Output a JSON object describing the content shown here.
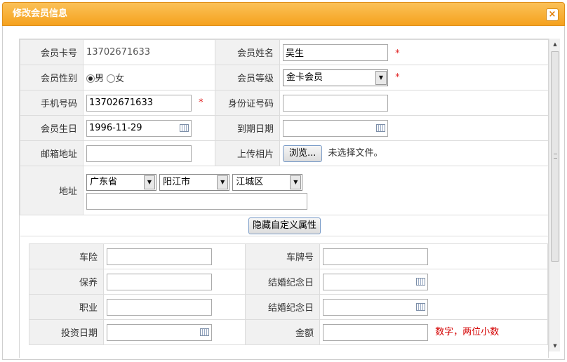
{
  "dialog": {
    "title": "修改会员信息",
    "close_label": "×"
  },
  "form": {
    "card_no_label": "会员卡号",
    "card_no_value": "13702671633",
    "name_label": "会员姓名",
    "name_value": "吴生",
    "gender_label": "会员性别",
    "gender_male": "男",
    "gender_female": "女",
    "gender_selected": "男",
    "level_label": "会员等级",
    "level_value": "金卡会员",
    "phone_label": "手机号码",
    "phone_value": "13702671633",
    "id_label": "身份证号码",
    "id_value": "",
    "birthday_label": "会员生日",
    "birthday_value": "1996-11-29",
    "expire_label": "到期日期",
    "expire_value": "",
    "email_label": "邮箱地址",
    "email_value": "",
    "photo_label": "上传相片",
    "browse_label": "浏览...",
    "no_file_label": "未选择文件。",
    "address_label": "地址",
    "province": "广东省",
    "city": "阳江市",
    "district": "江城区",
    "address_detail": "",
    "required_mark": "*"
  },
  "toggle_custom_label": "隐藏自定义属性",
  "custom": {
    "car_insurance_label": "车险",
    "plate_label": "车牌号",
    "maintenance_label": "保养",
    "wedding_label_1": "结婚纪念日",
    "job_label": "职业",
    "wedding_label_2": "结婚纪念日",
    "invest_date_label": "投资日期",
    "amount_label": "金额",
    "amount_hint": "数字，两位小数"
  },
  "icons": {
    "close": "close-icon",
    "calendar": "calendar-icon",
    "dropdown": "chevron-down-icon",
    "scroll_up": "scroll-up-icon",
    "scroll_down": "scroll-down-icon"
  }
}
